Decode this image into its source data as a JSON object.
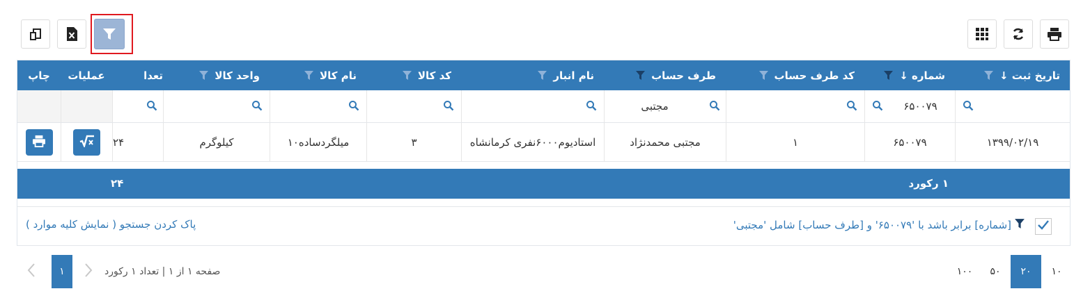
{
  "toolbar": {
    "left_icons": [
      "copy-icon",
      "excel-icon",
      "filter-icon"
    ],
    "right_icons": [
      "grid-icon",
      "refresh-icon",
      "print-icon"
    ]
  },
  "columns": [
    {
      "label": "تاریخ ثبت ↓",
      "filter": true
    },
    {
      "label": "شماره ↓",
      "filter": true
    },
    {
      "label": "کد طرف حساب",
      "filter": true
    },
    {
      "label": "طرف حساب",
      "filter": true
    },
    {
      "label": "نام انبار",
      "filter": true
    },
    {
      "label": "کد کالا",
      "filter": true
    },
    {
      "label": "نام کالا",
      "filter": true
    },
    {
      "label": "واحد کالا",
      "filter": true
    },
    {
      "label": "تعدا",
      "filter": false
    },
    {
      "label": "عملیات",
      "filter": false
    },
    {
      "label": "چاپ",
      "filter": false
    }
  ],
  "filters": {
    "date": "",
    "number": "۶۵۰۰۷۹",
    "party_code": "",
    "party": "مجتبی",
    "warehouse": "",
    "item_code": "",
    "item_name": "",
    "unit": "",
    "qty": ""
  },
  "rows": [
    {
      "date": "۱۳۹۹/۰۲/۱۹",
      "number": "۶۵۰۰۷۹",
      "party_code": "۱",
      "party": "مجتبی محمدنژاد",
      "warehouse": "استادیوم۶۰۰۰نفری کرمانشاه",
      "item_code": "۳",
      "item_name": "میلگردساده۱۰",
      "unit": "کیلوگرم",
      "qty": "۲۴"
    }
  ],
  "summary": {
    "records": "۱ رکورد",
    "total": "۲۴"
  },
  "filter_bar": {
    "expression": "[شماره] برابر باشد با '۶۵۰۰۷۹' و [طرف حساب] شامل 'مجتبی'",
    "clear_label": "پاک کردن جستجو ( نمایش کلیه موارد )"
  },
  "pager": {
    "page_sizes": [
      "۱۰",
      "۲۰",
      "۵۰",
      "۱۰۰"
    ],
    "selected_size": "۲۰",
    "current_page": "۱",
    "info": "صفحه ۱ از ۱ | تعداد ۱ رکورد"
  },
  "colors": {
    "header": "#337ab7",
    "active_filter_button": "#9cb5d6",
    "highlight_border": "#e0191f"
  }
}
